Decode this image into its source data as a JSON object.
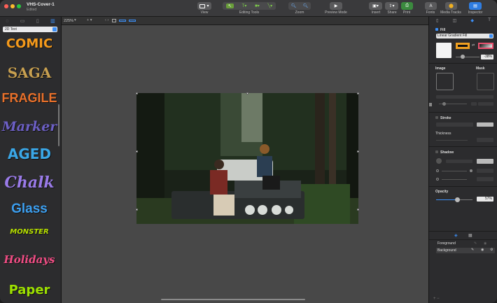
{
  "window": {
    "title": "VHS-Cover-1",
    "subtitle": "Edited"
  },
  "toolbar": {
    "view": "View",
    "editing_tools": "Editing Tools",
    "zoom": "Zoom",
    "preview_mode": "Preview Mode",
    "insert": "Insert",
    "share": "Share",
    "print": "Print",
    "fonts": "Fonts",
    "media_tracks": "Media Tracks",
    "inspector": "Inspector"
  },
  "sidebar": {
    "style_menu": "2D Text",
    "effects": [
      {
        "label": "COMIC",
        "color": "#f59a1b"
      },
      {
        "label": "SAGA",
        "color": "#c8a050"
      },
      {
        "label": "FRAGILE",
        "color": "#e8702a"
      },
      {
        "label": "Marker",
        "color": "#6c5fc4"
      },
      {
        "label": "AGED",
        "color": "#3aa6e6"
      },
      {
        "label": "Chalk",
        "color": "#9a7be8"
      },
      {
        "label": "Glass",
        "color": "#3c9ff0"
      },
      {
        "label": "MONSTER",
        "color": "#b7e000"
      },
      {
        "label": "Holidays",
        "color": "#f04d84"
      },
      {
        "label": "Paper",
        "color": "#9de000"
      }
    ]
  },
  "canvas": {
    "zoom_level": "225%"
  },
  "inspector": {
    "fill_label": "Fill",
    "fill_type": "Linear Gradient Fill",
    "fill_opacity": "-38%",
    "image_label": "Image",
    "mask_label": "Mask",
    "stroke_label": "Stroke",
    "thickness_label": "Thickness",
    "shadow_label": "Shadow",
    "opacity_label": "Opacity",
    "opacity_value": "57%",
    "opacity_fraction": 0.57,
    "layers": [
      {
        "label": "Foreground"
      },
      {
        "label": "Background"
      }
    ]
  },
  "colors": {
    "accent": "#3c8ff7",
    "swatch_orange": "#f0a020",
    "swatch_pink": "#e8506e"
  }
}
